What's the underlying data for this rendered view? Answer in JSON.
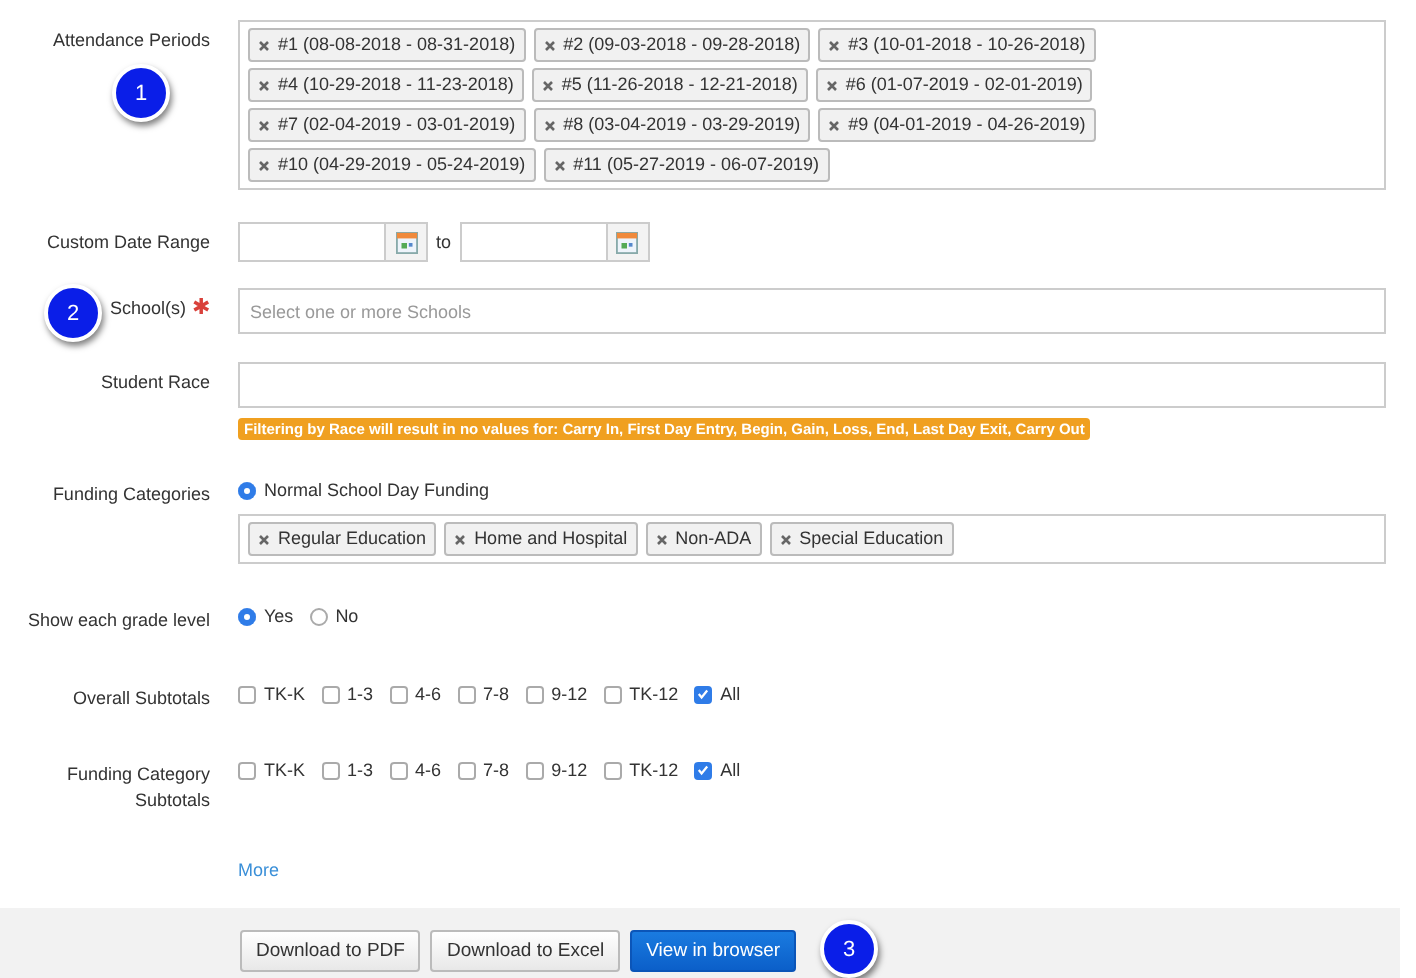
{
  "attendance_periods": {
    "label": "Attendance Periods",
    "callout": "1",
    "tags": [
      {
        "text": "#1 (08-08-2018 - 08-31-2018)"
      },
      {
        "text": "#2 (09-03-2018 - 09-28-2018)"
      },
      {
        "text": "#3 (10-01-2018 - 10-26-2018)"
      },
      {
        "text": "#4 (10-29-2018 - 11-23-2018)"
      },
      {
        "text": "#5 (11-26-2018 - 12-21-2018)"
      },
      {
        "text": "#6 (01-07-2019 - 02-01-2019)"
      },
      {
        "text": "#7 (02-04-2019 - 03-01-2019)"
      },
      {
        "text": "#8 (03-04-2019 - 03-29-2019)"
      },
      {
        "text": "#9 (04-01-2019 - 04-26-2019)"
      },
      {
        "text": "#10 (04-29-2019 - 05-24-2019)"
      },
      {
        "text": "#11 (05-27-2019 - 06-07-2019)"
      }
    ]
  },
  "custom_date_range": {
    "label": "Custom Date Range",
    "separator": "to"
  },
  "schools": {
    "label": "School(s)",
    "required_mark": "✱",
    "placeholder": "Select one or more Schools",
    "callout": "2"
  },
  "student_race": {
    "label": "Student Race",
    "warning": "Filtering by Race will result in no values for: Carry In, First Day Entry, Begin, Gain, Loss, End, Last Day Exit, Carry Out"
  },
  "funding_categories": {
    "label": "Funding Categories",
    "options": [
      {
        "label": "Normal School Day Funding",
        "selected": true
      }
    ],
    "tags": [
      {
        "text": "Regular Education"
      },
      {
        "text": "Home and Hospital"
      },
      {
        "text": "Non-ADA"
      },
      {
        "text": "Special Education"
      }
    ]
  },
  "show_grade_level": {
    "label": "Show each grade level",
    "options": [
      {
        "label": "Yes",
        "selected": true
      },
      {
        "label": "No",
        "selected": false
      }
    ]
  },
  "checkbox_groups": [
    {
      "label": "Overall Subtotals",
      "options": [
        {
          "label": "TK-K",
          "checked": false
        },
        {
          "label": "1-3",
          "checked": false
        },
        {
          "label": "4-6",
          "checked": false
        },
        {
          "label": "7-8",
          "checked": false
        },
        {
          "label": "9-12",
          "checked": false
        },
        {
          "label": "TK-12",
          "checked": false
        },
        {
          "label": "All",
          "checked": true
        }
      ]
    },
    {
      "label": "Funding Category Subtotals",
      "options": [
        {
          "label": "TK-K",
          "checked": false
        },
        {
          "label": "1-3",
          "checked": false
        },
        {
          "label": "4-6",
          "checked": false
        },
        {
          "label": "7-8",
          "checked": false
        },
        {
          "label": "9-12",
          "checked": false
        },
        {
          "label": "TK-12",
          "checked": false
        },
        {
          "label": "All",
          "checked": true
        }
      ]
    }
  ],
  "more_link": "More",
  "actions": {
    "callout": "3",
    "buttons": [
      {
        "label": "Download to PDF",
        "kind": "default"
      },
      {
        "label": "Download to Excel",
        "kind": "default"
      },
      {
        "label": "View in browser",
        "kind": "primary"
      }
    ]
  }
}
